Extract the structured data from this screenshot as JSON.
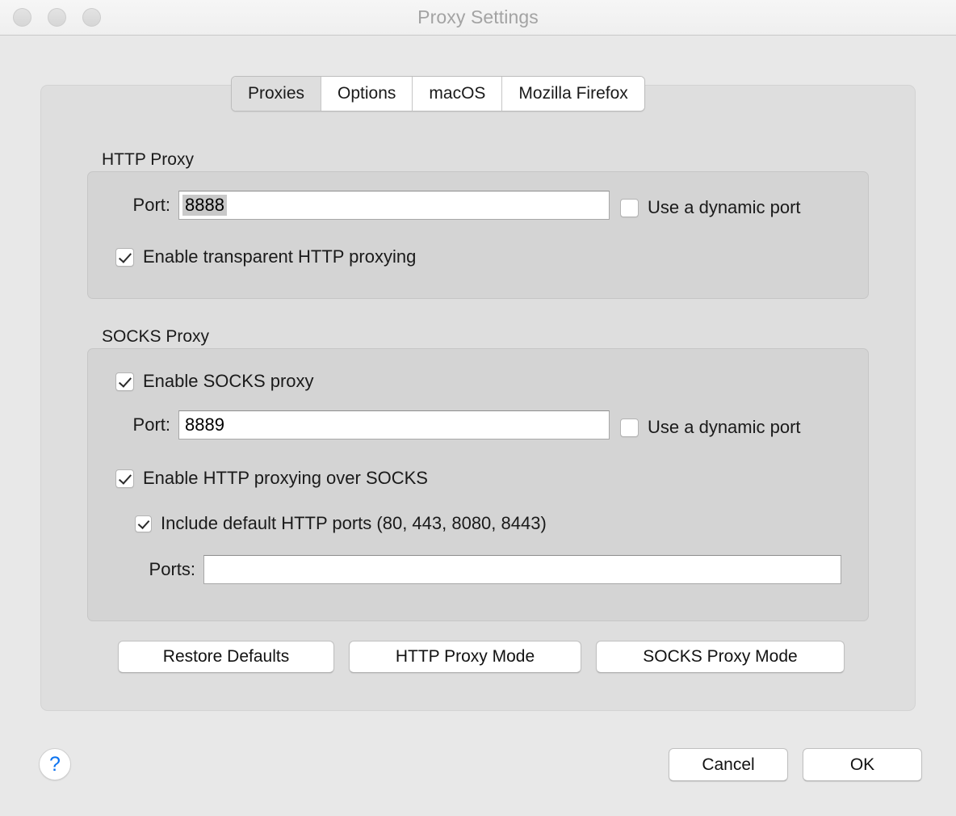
{
  "window": {
    "title": "Proxy Settings",
    "traffic_lights": [
      "close",
      "minimize",
      "zoom"
    ]
  },
  "tabs": [
    {
      "label": "Proxies",
      "selected": true
    },
    {
      "label": "Options",
      "selected": false
    },
    {
      "label": "macOS",
      "selected": false
    },
    {
      "label": "Mozilla Firefox",
      "selected": false
    }
  ],
  "http_proxy": {
    "group_label": "HTTP Proxy",
    "port_label": "Port:",
    "port_value": "8888",
    "port_value_selected": true,
    "dynamic_port_label": "Use a dynamic port",
    "dynamic_port_checked": false,
    "transparent_label": "Enable transparent HTTP proxying",
    "transparent_checked": true
  },
  "socks_proxy": {
    "group_label": "SOCKS Proxy",
    "enable_label": "Enable SOCKS proxy",
    "enable_checked": true,
    "port_label": "Port:",
    "port_value": "8889",
    "dynamic_port_label": "Use a dynamic port",
    "dynamic_port_checked": false,
    "http_over_socks_label": "Enable HTTP proxying over SOCKS",
    "http_over_socks_checked": true,
    "default_ports_label": "Include default HTTP ports (80, 443, 8080, 8443)",
    "default_ports_checked": true,
    "ports_label": "Ports:",
    "ports_value": "",
    "ports_placeholder": ""
  },
  "mode_buttons": {
    "restore_defaults": "Restore Defaults",
    "http_proxy_mode": "HTTP Proxy Mode",
    "socks_proxy_mode": "SOCKS Proxy Mode"
  },
  "footer": {
    "help_glyph": "?",
    "cancel": "Cancel",
    "ok": "OK"
  },
  "colors": {
    "window_bg": "#e8e8e8",
    "titlebar_bg": "#f4f4f4",
    "panel_bg": "#dedede",
    "group_bg": "#d4d4d4",
    "title_text": "#a3a3a3",
    "help_blue": "#0a72f0",
    "selection_gray": "#c9c9c9"
  }
}
